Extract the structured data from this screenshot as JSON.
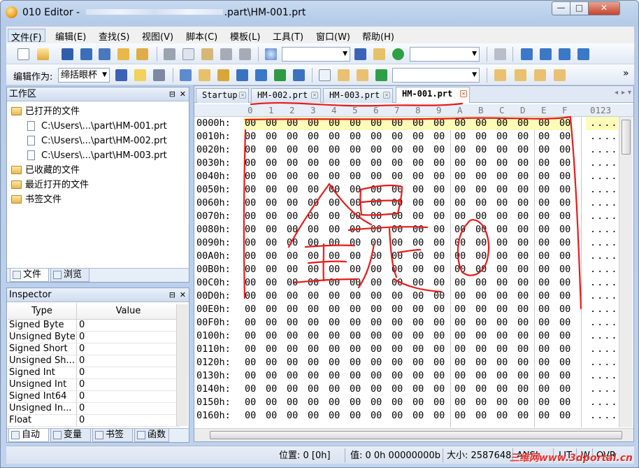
{
  "window": {
    "title_prefix": "010 Editor - ",
    "title_suffix": ".part\\HM-001.prt",
    "min_glyph": "—",
    "max_glyph": "□",
    "close_glyph": "✕"
  },
  "menu": [
    "文件(F)",
    "编辑(E)",
    "查找(S)",
    "视图(V)",
    "脚本(C)",
    "模板(L)",
    "工具(T)",
    "窗口(W)",
    "帮助(H)"
  ],
  "toolbar": {
    "edit_as_label": "编辑作为:",
    "edit_as_value": "缔括眼杯",
    "more_glyph": "»"
  },
  "workspace": {
    "title": "工作区",
    "tree": [
      {
        "label": "已打开的文件",
        "type": "folder"
      },
      {
        "label": "C:\\Users\\...\\part\\HM-001.prt",
        "type": "file"
      },
      {
        "label": "C:\\Users\\...\\part\\HM-002.prt",
        "type": "file"
      },
      {
        "label": "C:\\Users\\...\\part\\HM-003.prt",
        "type": "file"
      },
      {
        "label": "已收藏的文件",
        "type": "folder"
      },
      {
        "label": "最近打开的文件",
        "type": "folder"
      },
      {
        "label": "书签文件",
        "type": "folder"
      }
    ],
    "tabs": [
      "文件",
      "浏览"
    ]
  },
  "inspector": {
    "title": "Inspector",
    "col_type": "Type",
    "col_value": "Value",
    "rows": [
      {
        "type": "Signed Byte",
        "value": "0"
      },
      {
        "type": "Unsigned Byte",
        "value": "0"
      },
      {
        "type": "Signed Short",
        "value": "0"
      },
      {
        "type": "Unsigned Sh...",
        "value": "0"
      },
      {
        "type": "Signed Int",
        "value": "0"
      },
      {
        "type": "Unsigned Int",
        "value": "0"
      },
      {
        "type": "Signed Int64",
        "value": "0"
      },
      {
        "type": "Unsigned In...",
        "value": "0"
      },
      {
        "type": "Float",
        "value": "0"
      }
    ],
    "tabs": [
      "自动",
      "变量",
      "书签",
      "函数"
    ]
  },
  "editor": {
    "tabs": [
      {
        "label": "Startup",
        "active": false
      },
      {
        "label": "HM-002.prt",
        "active": false
      },
      {
        "label": "HM-003.prt",
        "active": false
      },
      {
        "label": "HM-001.prt",
        "active": true
      }
    ],
    "column_headers": [
      "0",
      "1",
      "2",
      "3",
      "4",
      "5",
      "6",
      "7",
      "8",
      "9",
      "A",
      "B",
      "C",
      "D",
      "E",
      "F"
    ],
    "ascii_header": "0123",
    "addresses": [
      "0000h:",
      "0010h:",
      "0020h:",
      "0030h:",
      "0040h:",
      "0050h:",
      "0060h:",
      "0070h:",
      "0080h:",
      "0090h:",
      "00A0h:",
      "00B0h:",
      "00C0h:",
      "00D0h:",
      "00E0h:",
      "00F0h:",
      "0100h:",
      "0110h:",
      "0120h:",
      "0130h:",
      "0140h:",
      "0150h:",
      "0160h:"
    ],
    "byte_value": "00",
    "ascii_value": "....",
    "highlight_row": 0
  },
  "status": {
    "position": "位置: 0 [0h]",
    "value": "值: 0 0h 00000000b",
    "size": "大小: 2587648",
    "encoding": "ANSI",
    "lit": "LIT",
    "w": "W",
    "ovr": "OVR"
  },
  "watermark": "三维网www.3dportal.cn",
  "annotation_color": "#e81b1b"
}
